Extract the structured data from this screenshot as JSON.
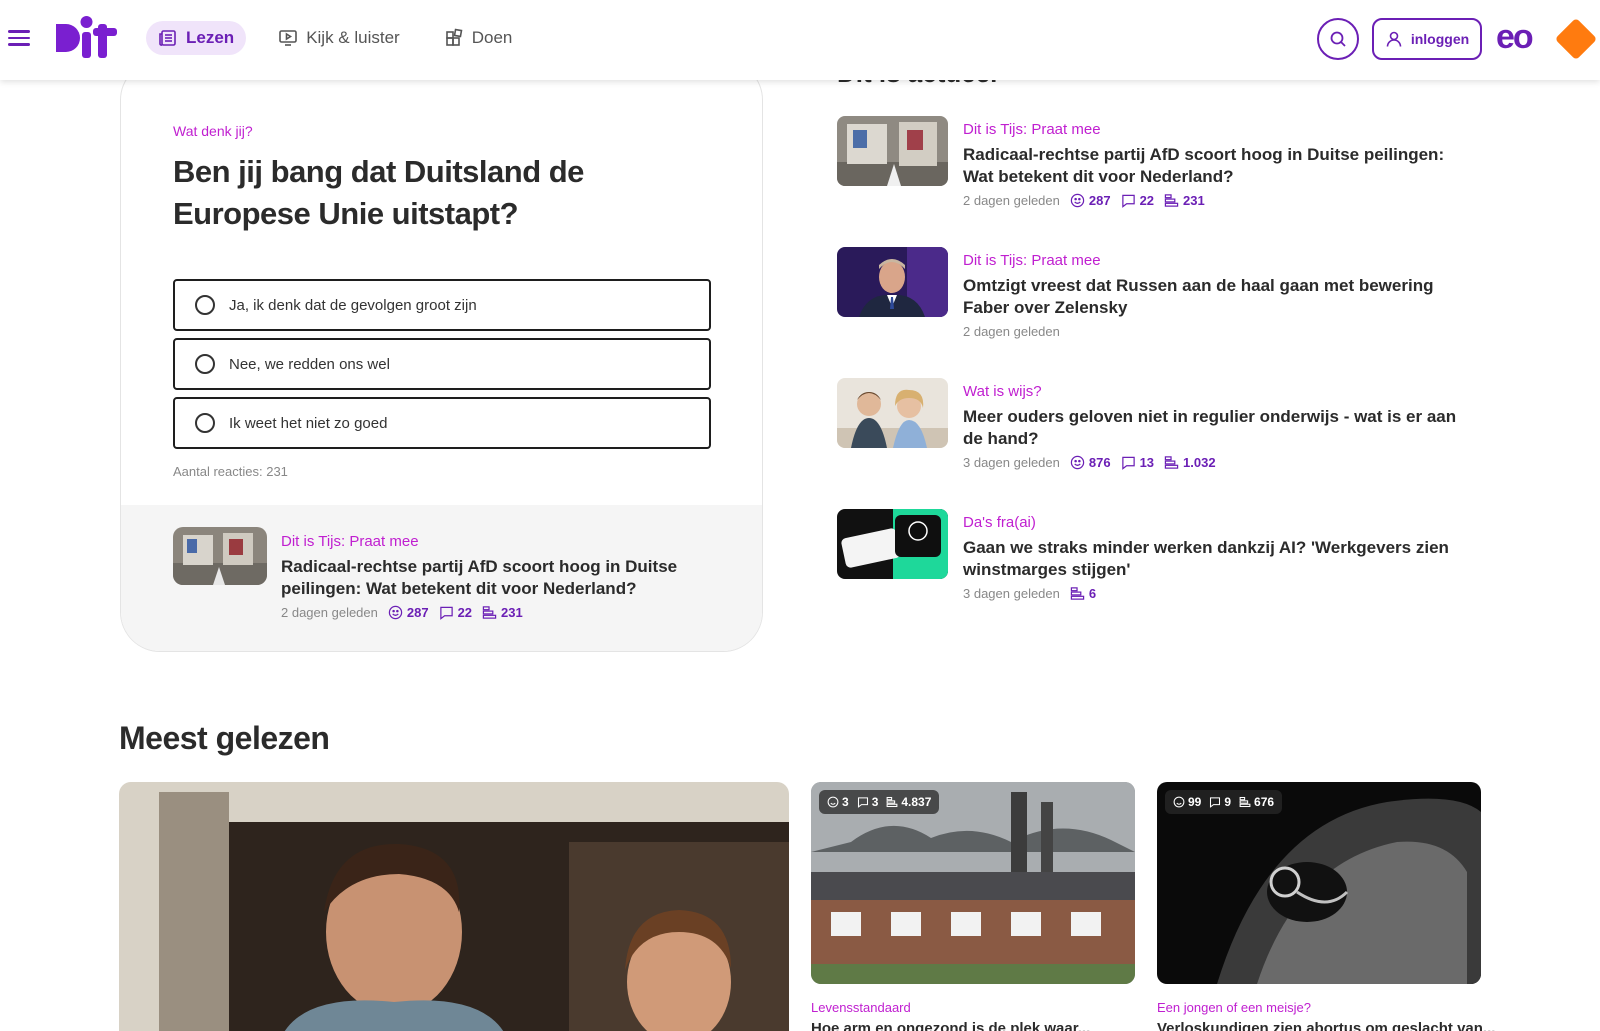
{
  "colors": {
    "brand": "#6b1fb5",
    "kicker": "#c01fd0",
    "npo": "#ff7b0f"
  },
  "header": {
    "logo_text": "DiT",
    "nav": [
      {
        "label": "Lezen",
        "icon": "newspaper-icon",
        "active": true
      },
      {
        "label": "Kijk & luister",
        "icon": "play-screen-icon",
        "active": false
      },
      {
        "label": "Doen",
        "icon": "blocks-icon",
        "active": false
      }
    ],
    "login_label": "inloggen",
    "eo_logo": "eo",
    "npo_logo": "npo"
  },
  "poll": {
    "kicker": "Wat denk jij?",
    "title": "Ben jij bang dat Duitsland de Europese Unie uitstapt?",
    "options": [
      "Ja, ik denk dat de gevolgen groot zijn",
      "Nee, we redden ons wel",
      "Ik weet het niet zo goed"
    ],
    "reactions": "Aantal reacties: 231",
    "related": {
      "kicker": "Dit is Tijs: Praat mee",
      "title": "Radicaal-rechtse partij AfD scoort hoog in Duitse peilingen: Wat betekent dit voor Nederland?",
      "time": "2 dagen geleden",
      "reactions": "287",
      "comments": "22",
      "votes": "231"
    }
  },
  "actueel": {
    "title": "Dit is actueel",
    "items": [
      {
        "kicker": "Dit is Tijs: Praat mee",
        "title": "Radicaal-rechtse partij AfD scoort hoog in Duitse peilingen: Wat betekent dit voor Nederland?",
        "time": "2 dagen geleden",
        "reactions": "287",
        "comments": "22",
        "votes": "231"
      },
      {
        "kicker": "Dit is Tijs: Praat mee",
        "title": "Omtzigt vreest dat Russen aan de haal gaan met bewering Faber over Zelensky",
        "time": "2 dagen geleden"
      },
      {
        "kicker": "Wat is wijs?",
        "title": "Meer ouders geloven niet in regulier onderwijs - wat is er aan de hand?",
        "time": "3 dagen geleden",
        "reactions": "876",
        "comments": "13",
        "votes": "1.032"
      },
      {
        "kicker": "Da's fra(ai)",
        "title": "Gaan we straks minder werken dankzij AI? 'Werkgevers zien winstmarges stijgen'",
        "time": "3 dagen geleden",
        "votes": "6"
      }
    ]
  },
  "meest_gelezen": {
    "title": "Meest gelezen",
    "cards": [
      {
        "reactions": "3",
        "comments": "3",
        "votes": "4.837",
        "kicker": "Levensstandaard",
        "title": "Hoe arm en ongezond is de plek waar..."
      },
      {
        "reactions": "99",
        "comments": "9",
        "votes": "676",
        "kicker": "Een jongen of een meisje?",
        "title": "Verloskundigen zien abortus om geslacht van..."
      }
    ]
  }
}
